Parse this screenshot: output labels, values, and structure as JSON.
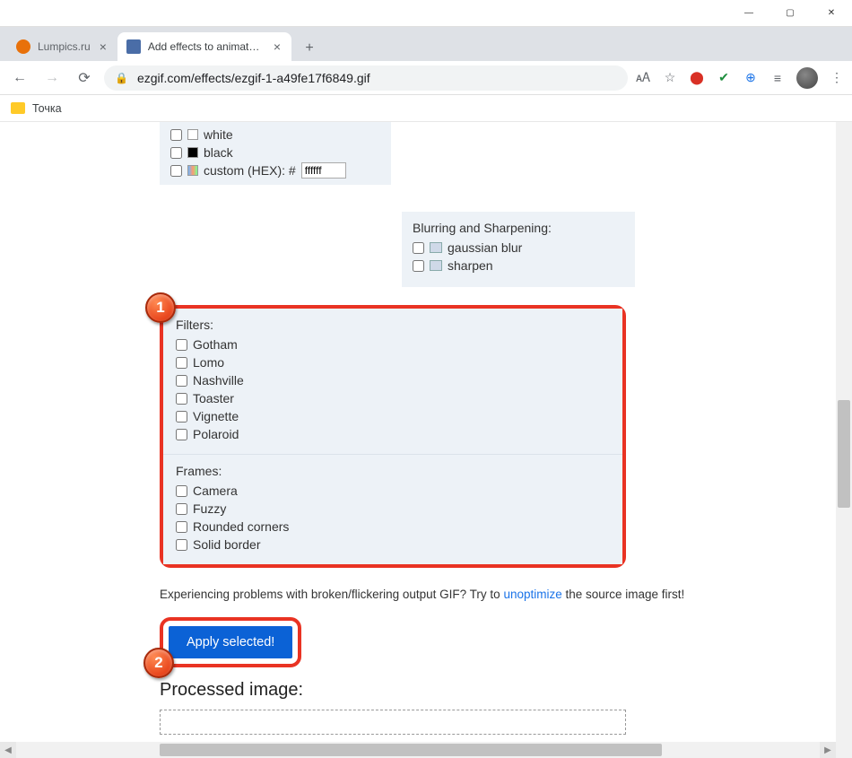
{
  "window": {
    "tabs": [
      {
        "title": "Lumpics.ru"
      },
      {
        "title": "Add effects to animated gifs - gif..."
      }
    ],
    "url": "ezgif.com/effects/ezgif-1-a49fe17f6849.gif",
    "bookmark": "Точка"
  },
  "colors": {
    "white": "white",
    "black": "black",
    "custom_prefix": "custom (HEX): #",
    "custom_value": "ffffff"
  },
  "blur": {
    "title": "Blurring and Sharpening:",
    "items": [
      "gaussian blur",
      "sharpen"
    ]
  },
  "filters": {
    "title": "Filters:",
    "items": [
      "Gotham",
      "Lomo",
      "Nashville",
      "Toaster",
      "Vignette",
      "Polaroid"
    ]
  },
  "frames": {
    "title": "Frames:",
    "items": [
      "Camera",
      "Fuzzy",
      "Rounded corners",
      "Solid border"
    ]
  },
  "tip": {
    "before": "Experiencing problems with broken/flickering output GIF? Try to ",
    "link": "unoptimize",
    "after": " the source image first!"
  },
  "apply_label": "Apply selected!",
  "processed_title": "Processed image:",
  "badges": {
    "one": "1",
    "two": "2"
  }
}
